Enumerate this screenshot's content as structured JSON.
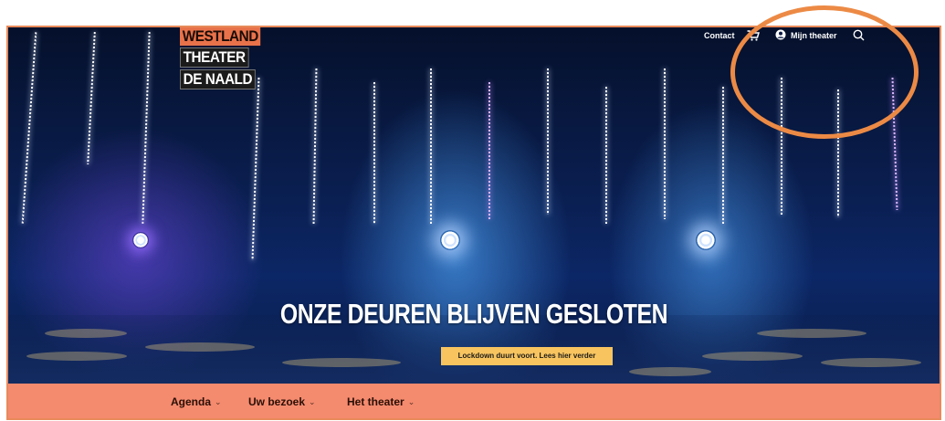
{
  "logo": {
    "line1": "WESTLAND",
    "line2": "THEATER",
    "line3": "DE NAALD"
  },
  "top_nav": {
    "contact_label": "Contact",
    "cart_icon": "cart-icon",
    "account_icon": "user-circle-icon",
    "account_label": "Mijn theater",
    "search_icon": "search-icon"
  },
  "hero": {
    "headline": "ONZE DEUREN BLIJVEN GESLOTEN",
    "cta_label": "Lockdown duurt voort. Lees hier verder"
  },
  "main_nav": {
    "items": [
      {
        "label": "Agenda"
      },
      {
        "label": "Uw bezoek"
      },
      {
        "label": "Het theater"
      }
    ]
  },
  "colors": {
    "brand_orange": "#e8724a",
    "nav_bar": "#f48a6e",
    "cta_yellow": "#f7c45f",
    "annotation_circle": "#ec8a45"
  }
}
